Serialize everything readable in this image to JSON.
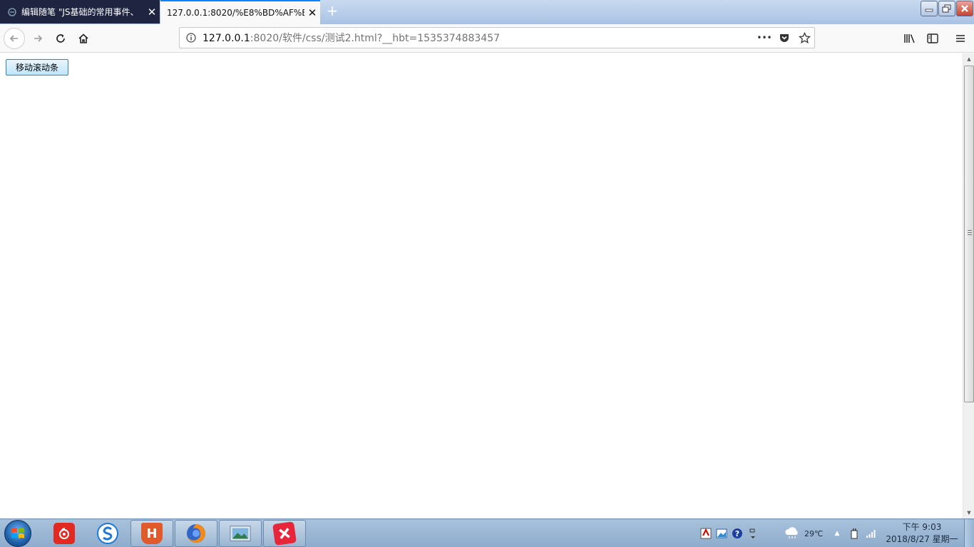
{
  "tabs": [
    {
      "title": "编辑随笔 \"JS基础的常用事件、",
      "close": "✕",
      "active": false
    },
    {
      "title": "127.0.0.1:8020/%E8%BD%AF%E4",
      "close": "✕",
      "active": true
    }
  ],
  "new_tab_label": "+",
  "navbar": {
    "url_host": "127.0.0.1",
    "url_rest": ":8020/软件/css/测试2.html?__hbt=1535374883457",
    "more_label": "•••"
  },
  "page": {
    "move_button_label": "移动滚动条"
  },
  "scrollbar": {
    "position_fraction": 0.0
  },
  "taskbar": {
    "apps": [
      "netease-music",
      "sogou-browser",
      "hbuilder",
      "firefox",
      "photo-viewer",
      "xmind"
    ],
    "weather_temp": "29℃",
    "clock_time": "下午 9:03",
    "clock_date": "2018/8/27 星期一",
    "hbuilder_letter": "H"
  },
  "colors": {
    "accent": "#0a84ff",
    "inactive_tab_bg": "#1f2440",
    "netease_red": "#e22a23",
    "hbuilder_orange": "#e05a2b",
    "xmind_red": "#e8263a"
  }
}
